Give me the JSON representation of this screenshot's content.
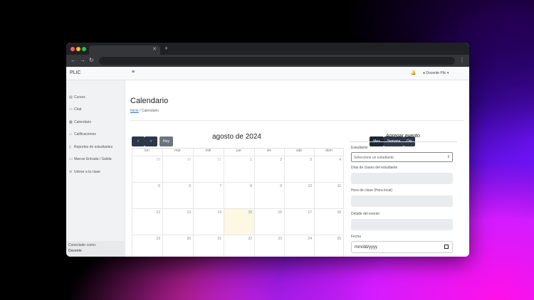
{
  "app": {
    "brand": "PLIC",
    "user_label": "Docente Plic"
  },
  "sidebar": {
    "items": [
      {
        "label": "Cursos",
        "icon": "book-icon"
      },
      {
        "label": "Chat",
        "icon": "chat-icon"
      },
      {
        "label": "Calendario",
        "icon": "calendar-icon"
      },
      {
        "label": "Calificaciones",
        "icon": "grades-icon"
      },
      {
        "label": "Reportes de estudiantes",
        "icon": "report-icon"
      },
      {
        "label": "Marcar Entrada / Salida",
        "icon": "clock-icon"
      },
      {
        "label": "Unirse a la clase",
        "icon": "link-icon"
      }
    ],
    "footer_line1": "Conectado como:",
    "footer_line2": "Docente"
  },
  "page": {
    "title": "Calendario",
    "breadcrumb_home": "Inicio",
    "breadcrumb_sep": "/",
    "breadcrumb_current": "Calendario"
  },
  "calendar": {
    "today_label": "Hoy",
    "title": "agosto de 2024",
    "views": [
      "Mes",
      "Semana",
      "Día"
    ],
    "days": [
      "lun",
      "mar",
      "mié",
      "jue",
      "vie",
      "sáb",
      "dom"
    ],
    "weeks": [
      [
        "29",
        "30",
        "31",
        "1",
        "2",
        "3",
        "4"
      ],
      [
        "5",
        "6",
        "7",
        "8",
        "9",
        "10",
        "11"
      ],
      [
        "12",
        "13",
        "14",
        "15",
        "16",
        "17",
        "18"
      ],
      [
        "19",
        "20",
        "21",
        "22",
        "23",
        "24",
        "25"
      ]
    ]
  },
  "form": {
    "title": "Agregar evento",
    "student_label": "Estudiante",
    "student_placeholder": "Seleccione un estudiante",
    "days_label": "Días de clases del estudiante",
    "hour_label": "Hora de clase (Hora local)",
    "detail_label": "Detalle del evento",
    "date_label": "Fecha",
    "date_placeholder": "mm/dd/yyyy"
  }
}
